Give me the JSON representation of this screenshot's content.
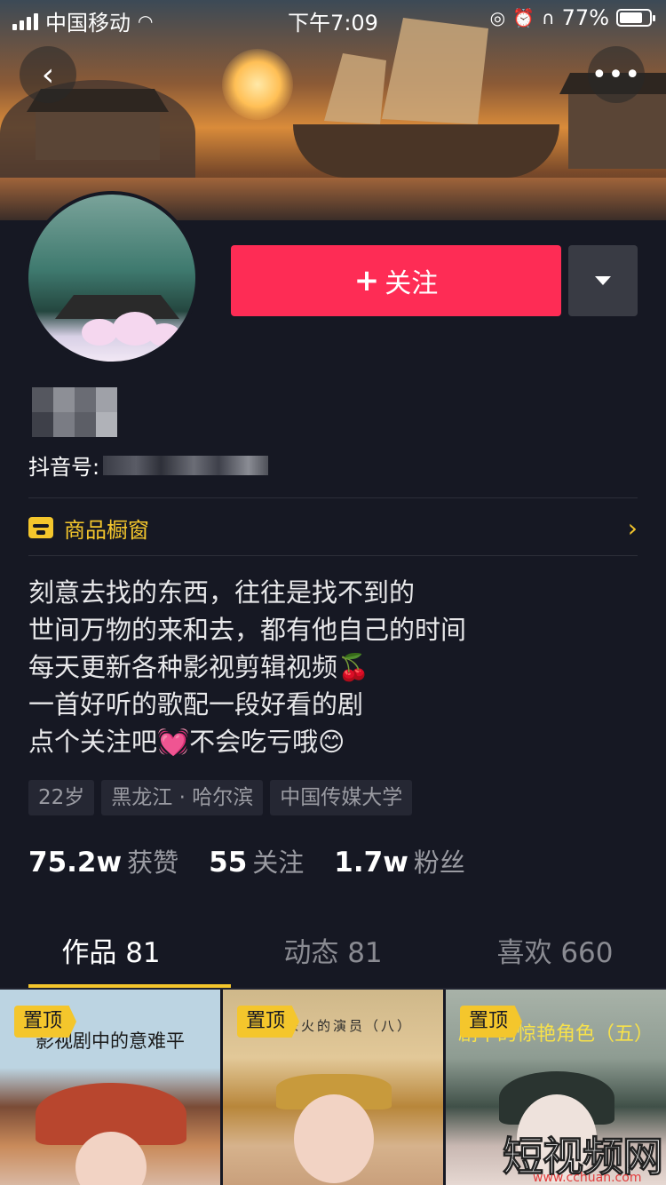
{
  "status_bar": {
    "carrier": "中国移动",
    "time": "下午7:09",
    "battery": "77%",
    "battery_level": 0.77
  },
  "header": {
    "back_icon": "chevron-left-icon",
    "more_icon": "more-horizontal-icon"
  },
  "profile": {
    "follow_plus": "+",
    "follow_label": "关注",
    "douyin_id_label": "抖音号:",
    "shop_label": "商品橱窗",
    "shop_arrow": "›",
    "bio": [
      "刻意去找的东西，往往是找不到的",
      "世间万物的来和去，都有他自己的时间",
      "每天更新各种影视剪辑视频🍒",
      "一首好听的歌配一段好看的剧",
      "点个关注吧💓不会吃亏哦😊"
    ],
    "tags": [
      "22岁",
      "黑龙江 · 哈尔滨",
      "中国传媒大学"
    ],
    "stats": [
      {
        "num": "75.2w",
        "label": "获赞"
      },
      {
        "num": "55",
        "label": "关注"
      },
      {
        "num": "1.7w",
        "label": "粉丝"
      }
    ]
  },
  "tabs": [
    {
      "label": "作品 81",
      "active": true
    },
    {
      "label": "动态 81",
      "active": false
    },
    {
      "label": "喜欢 660",
      "active": false
    }
  ],
  "videos": [
    {
      "pin": "置顶",
      "title": "影视剧中的意难平"
    },
    {
      "pin": "置顶",
      "title": "好却未火的演员（八）"
    },
    {
      "pin": "置顶",
      "title": "剧中的惊艳角色（五）"
    }
  ],
  "watermark": {
    "text": "短视频网",
    "url": "www.cchuan.com"
  },
  "colors": {
    "accent": "#fe2c55",
    "highlight": "#f4c62c",
    "background": "#161823"
  }
}
